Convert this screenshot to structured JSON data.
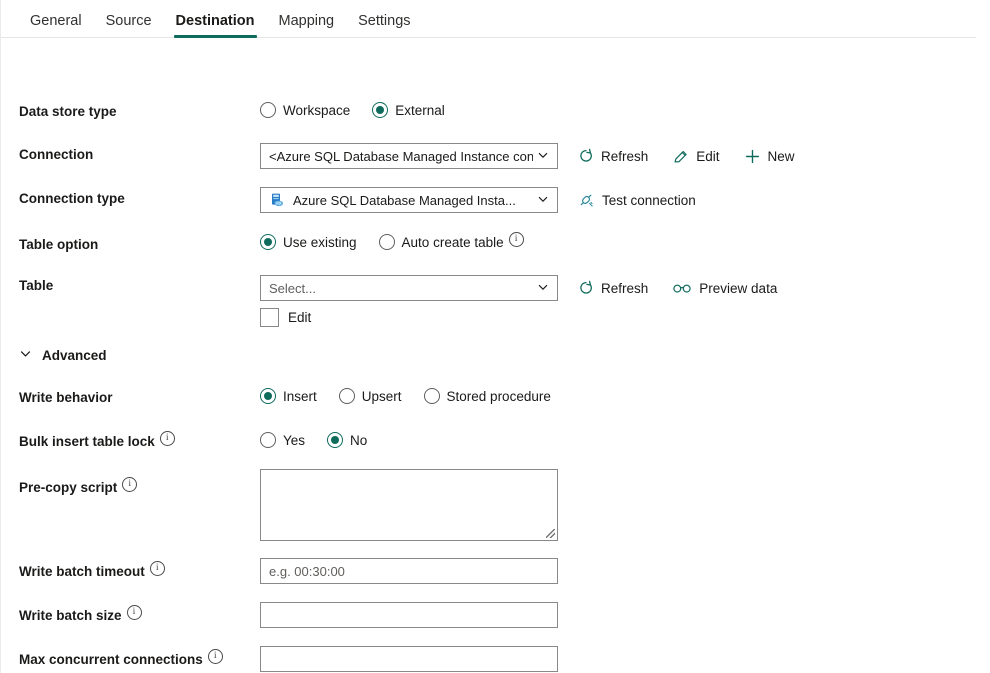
{
  "tabs": [
    {
      "label": "General",
      "active": false
    },
    {
      "label": "Source",
      "active": false
    },
    {
      "label": "Destination",
      "active": true
    },
    {
      "label": "Mapping",
      "active": false
    },
    {
      "label": "Settings",
      "active": false
    }
  ],
  "accent_color": "#0f6b5c",
  "form": {
    "data_store_type": {
      "label": "Data store type",
      "options": [
        {
          "label": "Workspace",
          "selected": false
        },
        {
          "label": "External",
          "selected": true
        }
      ]
    },
    "connection": {
      "label": "Connection",
      "value": "<Azure SQL Database Managed Instance connection>",
      "commands": [
        {
          "label": "Refresh",
          "icon": "refresh-icon"
        },
        {
          "label": "Edit",
          "icon": "pencil-icon"
        },
        {
          "label": "New",
          "icon": "plus-icon"
        }
      ]
    },
    "connection_type": {
      "label": "Connection type",
      "value": "Azure SQL Database Managed Insta...",
      "icon": "sql-database-icon",
      "commands": [
        {
          "label": "Test connection",
          "icon": "plug-icon"
        }
      ]
    },
    "table_option": {
      "label": "Table option",
      "options": [
        {
          "label": "Use existing",
          "selected": true,
          "info": false
        },
        {
          "label": "Auto create table",
          "selected": false,
          "info": true
        }
      ]
    },
    "table": {
      "label": "Table",
      "placeholder": "Select...",
      "edit_checkbox_label": "Edit",
      "edit_checked": false,
      "commands": [
        {
          "label": "Refresh",
          "icon": "refresh-icon"
        },
        {
          "label": "Preview data",
          "icon": "glasses-icon"
        }
      ]
    },
    "advanced": {
      "label": "Advanced",
      "expanded": true,
      "write_behavior": {
        "label": "Write behavior",
        "options": [
          {
            "label": "Insert",
            "selected": true
          },
          {
            "label": "Upsert",
            "selected": false
          },
          {
            "label": "Stored procedure",
            "selected": false
          }
        ]
      },
      "bulk_insert_table_lock": {
        "label": "Bulk insert table lock",
        "info": true,
        "options": [
          {
            "label": "Yes",
            "selected": false
          },
          {
            "label": "No",
            "selected": true
          }
        ]
      },
      "pre_copy_script": {
        "label": "Pre-copy script",
        "info": true,
        "value": ""
      },
      "write_batch_timeout": {
        "label": "Write batch timeout",
        "info": true,
        "value": "",
        "placeholder": "e.g. 00:30:00"
      },
      "write_batch_size": {
        "label": "Write batch size",
        "info": true,
        "value": "",
        "placeholder": ""
      },
      "max_concurrent_connections": {
        "label": "Max concurrent connections",
        "info": true,
        "value": "",
        "placeholder": ""
      }
    }
  }
}
